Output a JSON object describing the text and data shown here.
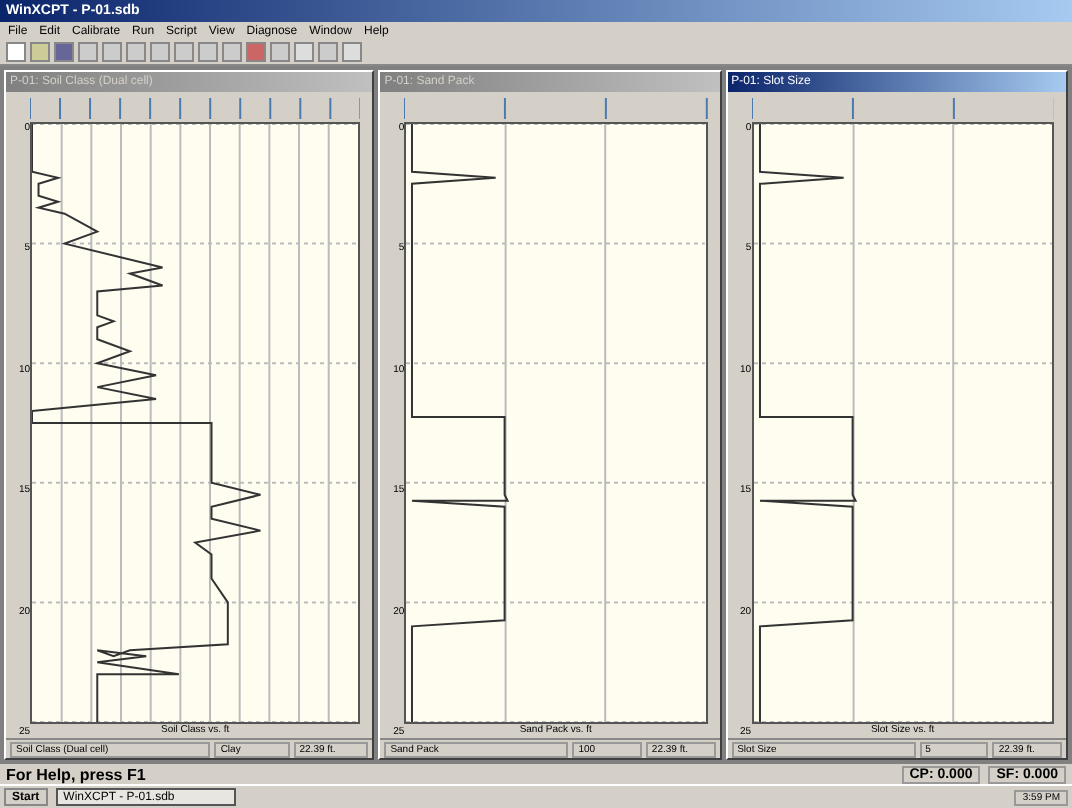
{
  "window": {
    "title": "WinXCPT - P-01.sdb"
  },
  "menu": [
    "File",
    "Edit",
    "Calibrate",
    "Run",
    "Script",
    "View",
    "Diagnose",
    "Window",
    "Help"
  ],
  "children": [
    {
      "title": "P-01: Soil Class (Dual cell)",
      "selected": false,
      "kind": "soil",
      "yticks": [
        "0",
        "5",
        "10",
        "15",
        "20",
        "25"
      ],
      "caption": "Soil Class vs. ft",
      "footer": [
        "Soil Class (Dual cell)",
        "Clay",
        "22.39 ft."
      ]
    },
    {
      "title": "P-01: Sand Pack",
      "selected": false,
      "kind": "sand",
      "yticks": [
        "0",
        "5",
        "10",
        "15",
        "20",
        "25"
      ],
      "caption": "Sand Pack vs. ft",
      "footer": [
        "Sand Pack",
        "100",
        "22.39 ft."
      ]
    },
    {
      "title": "P-01: Slot Size",
      "selected": true,
      "kind": "slot",
      "yticks": [
        "0",
        "5",
        "10",
        "15",
        "20",
        "25"
      ],
      "caption": "Slot Size vs. ft",
      "footer": [
        "Slot Size",
        "5",
        "22.39 ft."
      ]
    }
  ],
  "status_bar": {
    "text": "For Help, press F1",
    "fields": [
      "CP: 0.000",
      "SF: 0.000"
    ]
  },
  "taskbar": {
    "start": "Start",
    "task": "WinXCPT - P-01.sdb",
    "clock": "3:59 PM"
  }
}
